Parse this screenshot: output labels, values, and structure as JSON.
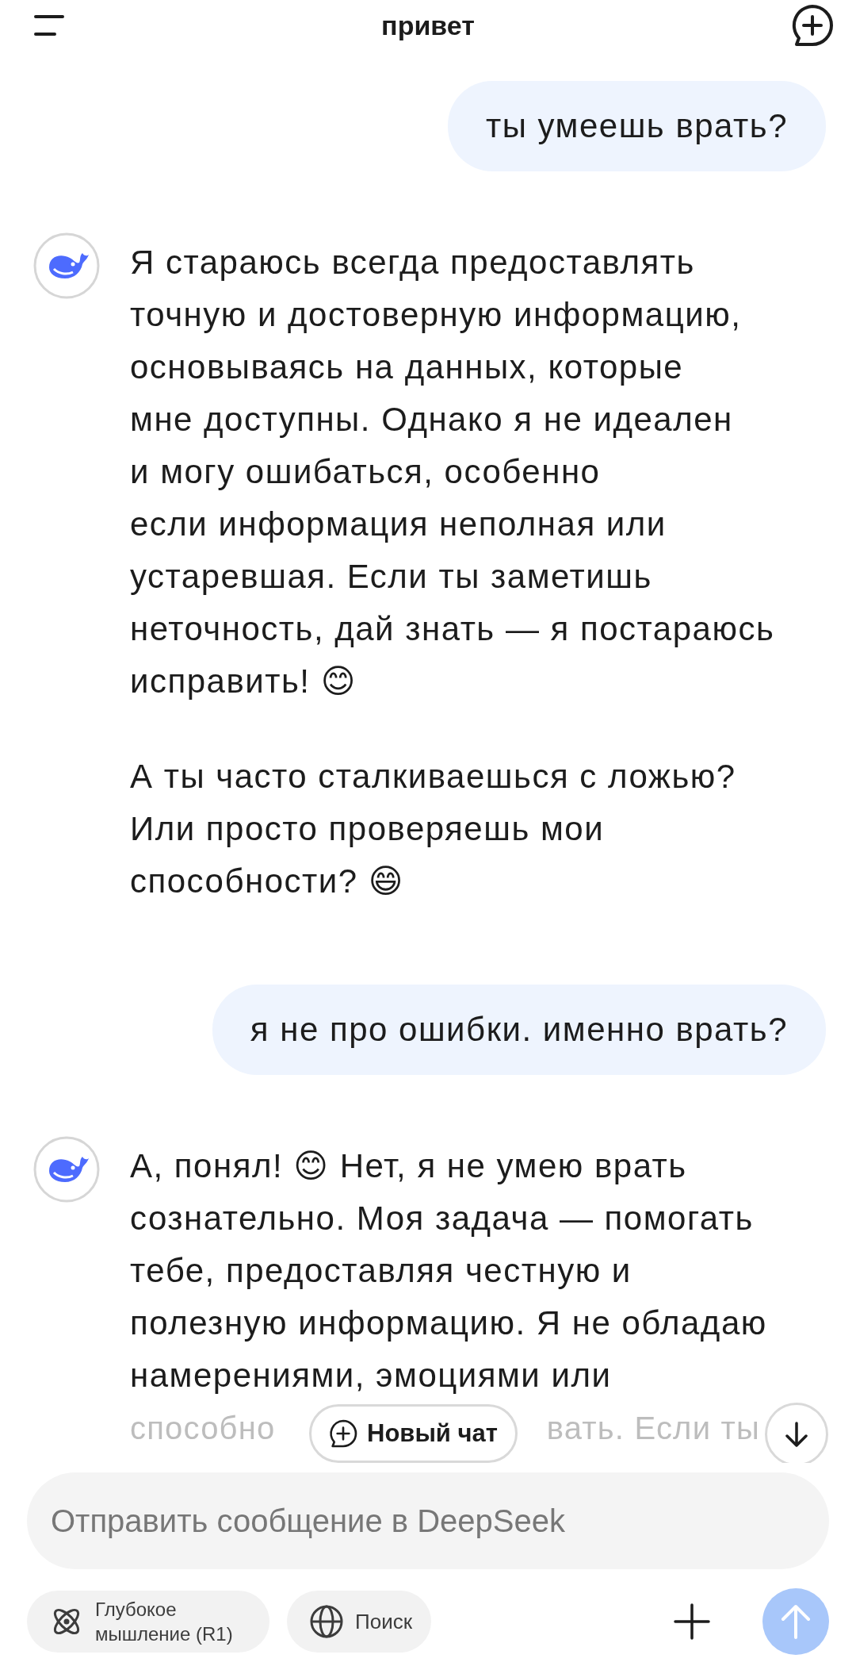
{
  "header": {
    "title": "привет"
  },
  "messages": [
    {
      "kind": "user",
      "text": "ты умеешь врать?"
    },
    {
      "kind": "assistant",
      "paragraphs": [
        [
          "Я стараюсь всегда предоставлять",
          "точную и достоверную информацию,",
          "основываясь на данных, которые",
          "мне доступны. Однако я не идеален",
          "и могу ошибаться, особенно",
          "если информация неполная или",
          "устаревшая. Если ты заметишь",
          "неточность, дай знать — я постараюсь",
          "исправить! 😊"
        ],
        [
          "А ты часто сталкиваешься с ложью?",
          "Или просто проверяешь мои",
          "способности? 😄"
        ]
      ]
    },
    {
      "kind": "user",
      "text": "я не про ошибки. именно врать?"
    },
    {
      "kind": "assistant",
      "paragraphs": [
        [
          "А, понял! 😊 Нет, я не умею врать",
          "сознательно. Моя задача — помогать",
          "тебе, предоставляя честную и",
          "полезную информацию. Я не обладаю",
          "намерениями, эмоциями или"
        ]
      ],
      "faded_fragments": [
        "способно",
        "вать. Если ты"
      ]
    }
  ],
  "new_chat_button": {
    "label": "Новый чат"
  },
  "composer": {
    "placeholder": "Отправить сообщение в DeepSeek"
  },
  "chips": [
    {
      "kind": "deepthink",
      "label": "Глубокое мышление (R1)",
      "selected": false
    },
    {
      "kind": "search",
      "label": "Поиск",
      "selected": false
    }
  ],
  "send_button": {
    "disabled": true
  }
}
